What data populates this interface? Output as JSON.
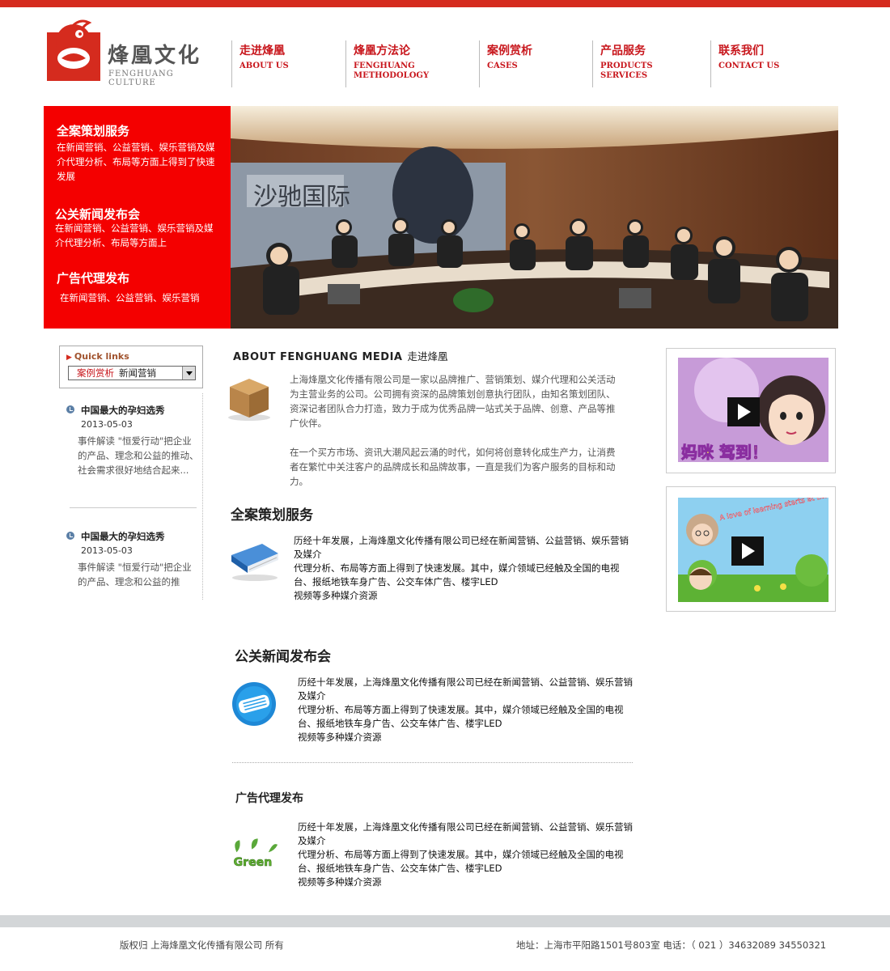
{
  "brand": {
    "name_cn": "烽凰文化",
    "name_en": "FENGHUANG CULTURE",
    "accent": "#d52b1e",
    "red": "#f40000"
  },
  "nav": [
    {
      "cn": "走进烽凰",
      "en": "ABOUT US"
    },
    {
      "cn": "烽凰方法论",
      "en": "FENGHUANG\nMETHODOLOGY"
    },
    {
      "cn": "案例赏析",
      "en": "CASES"
    },
    {
      "cn": "产品服务",
      "en": "PRODUCTS\nSERVICES"
    },
    {
      "cn": "联系我们",
      "en": "CONTACT US"
    }
  ],
  "banner": {
    "items": [
      {
        "title": "全案策划服务",
        "text": "在新闻营销、公益营销、娱乐营销及媒介代理分析、布局等方面上得到了快速发展"
      },
      {
        "title": "公关新闻发布会",
        "text": "在新闻营销、公益营销、娱乐营销及媒介代理分析、布局等方面上"
      },
      {
        "title": "广告代理发布",
        "text": "在新闻营销、公益营销、娱乐营销"
      }
    ],
    "photo_text": "沙驰国际"
  },
  "quick_links": {
    "title": "Quick links",
    "selected_a": "案例赏析",
    "selected_b": "新闻营销"
  },
  "news": [
    {
      "title": "中国最大的孕妇选秀",
      "date": "2013-05-03",
      "summary": "事件解读 \"恒爱行动\"把企业的产品、理念和公益的推动、社会需求很好地结合起来..."
    },
    {
      "title": "中国最大的孕妇选秀",
      "date": "2013-05-03",
      "summary": "事件解读 \"恒爱行动\"把企业的产品、理念和公益的推"
    }
  ],
  "about": {
    "title": "ABOUT FENGHUANG MEDIA",
    "subtitle": "走进烽凰",
    "p1": "上海烽凰文化传播有限公司是一家以品牌推广、营销策划、媒介代理和公关活动为主营业务的公司。公司拥有资深的品牌策划创意执行团队，由知名策划团队、资深记者团队合力打造，致力于成为优秀品牌一站式关于品牌、创意、产品等推广伙伴。",
    "p2": "在一个买方市场、资讯大潮风起云涌的时代，如何将创意转化成生产力，让消费者在繁忙中关注客户的品牌成长和品牌故事，一直是我们为客户服务的目标和动力。"
  },
  "sections": [
    {
      "title": "全案策划服务",
      "body": "历经十年发展，上海烽凰文化传播有限公司已经在新闻营销、公益营销、娱乐营销及媒介\n代理分析、布局等方面上得到了快速发展。其中，媒介领域已经触及全国的电视台、报纸地铁车身广告、公交车体广告、楼宇LED\n视频等多种媒介资源"
    },
    {
      "title": "公关新闻发布会",
      "body": "历经十年发展，上海烽凰文化传播有限公司已经在新闻营销、公益营销、娱乐营销及媒介\n代理分析、布局等方面上得到了快速发展。其中，媒介领域已经触及全国的电视台、报纸地铁车身广告、公交车体广告、楼宇LED\n视频等多种媒介资源"
    },
    {
      "title": "广告代理发布",
      "body": "历经十年发展，上海烽凰文化传播有限公司已经在新闻营销、公益营销、娱乐营销及媒介\n代理分析、布局等方面上得到了快速发展。其中，媒介领域已经触及全国的电视台、报纸地铁车身广告、公交车体广告、楼宇LED\n视频等多种媒介资源"
    }
  ],
  "section_icons": [
    "book-icon",
    "newspaper-icon",
    "green-leaf-icon"
  ],
  "green_label": "Green",
  "videos": [
    {
      "caption": "妈咪 驾到！"
    },
    {
      "caption": "A love of learning starts at Etonkids"
    }
  ],
  "footer": {
    "copyright": "版权归 上海烽凰文化传播有限公司 所有",
    "contact": "地址：上海市平阳路1501号803室 电话：（ 021 ）34632089 34550321"
  }
}
